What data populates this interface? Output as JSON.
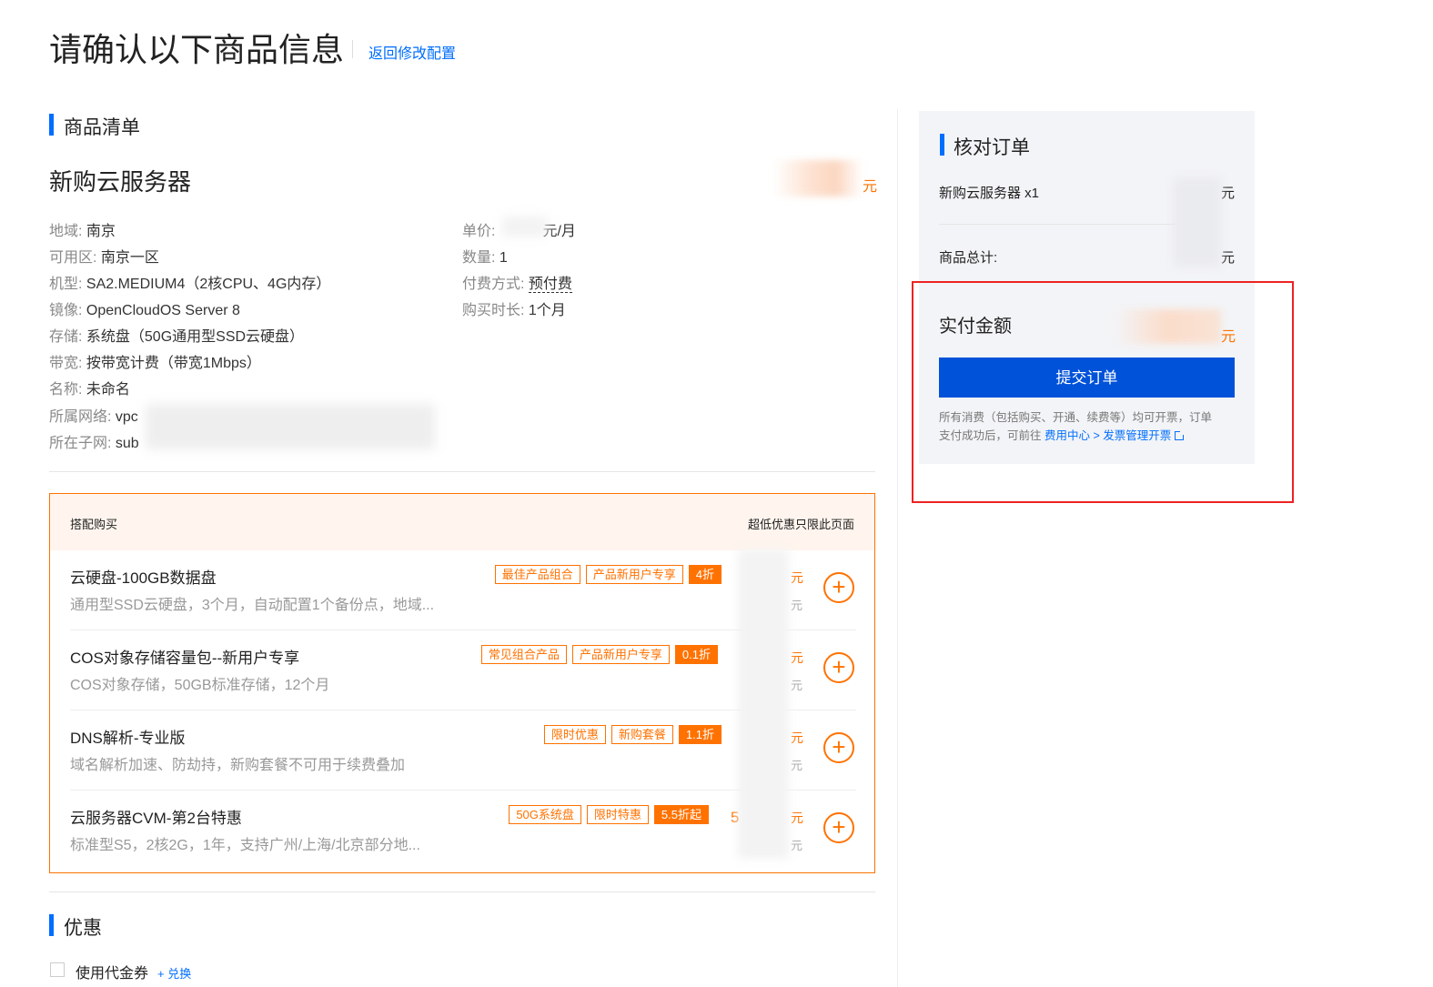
{
  "header": {
    "title": "请确认以下商品信息",
    "back_link": "返回修改配置"
  },
  "product_list": {
    "section_title": "商品清单",
    "product_name": "新购云服务器",
    "price_unit": "元",
    "specs_left": [
      {
        "label": "地域:",
        "value": "南京"
      },
      {
        "label": "可用区:",
        "value": "南京一区"
      },
      {
        "label": "机型:",
        "value": "SA2.MEDIUM4（2核CPU、4G内存）"
      },
      {
        "label": "镜像:",
        "value": "OpenCloudOS Server 8"
      },
      {
        "label": "存储:",
        "value": "系统盘（50G通用型SSD云硬盘）"
      },
      {
        "label": "带宽:",
        "value": "按带宽计费（带宽1Mbps）"
      },
      {
        "label": "名称:",
        "value": "未命名"
      },
      {
        "label": "所属网络:",
        "value": "vpc"
      },
      {
        "label": "所在子网:",
        "value": "sub"
      }
    ],
    "specs_right": [
      {
        "label": "单价:",
        "value": "元/月"
      },
      {
        "label": "数量:",
        "value": "1"
      },
      {
        "label": "付费方式:",
        "value": "预付费"
      },
      {
        "label": "购买时长:",
        "value": "1个月"
      }
    ]
  },
  "addons": {
    "header_left": "搭配购买",
    "header_right": "超低优惠只限此页面",
    "yuan": "元",
    "items": [
      {
        "name": "云硬盘-100GB数据盘",
        "desc": "通用型SSD云硬盘，3个月，自动配置1个备份点，地域...",
        "tags": [
          "最佳产品组合",
          "产品新用户专享"
        ],
        "discount": "4折"
      },
      {
        "name": "COS对象存储容量包--新用户专享",
        "desc": "COS对象存储，50GB标准存储，12个月",
        "tags": [
          "常见组合产品",
          "产品新用户专享"
        ],
        "discount": "0.1折"
      },
      {
        "name": "DNS解析-专业版",
        "desc": "域名解析加速、防劫持，新购套餐不可用于续费叠加",
        "tags": [
          "限时优惠",
          "新购套餐"
        ],
        "discount": "1.1折"
      },
      {
        "name": "云服务器CVM-第2台特惠",
        "desc": "标准型S5，2核2G，1年，支持广州/上海/北京部分地...",
        "tags": [
          "50G系统盘",
          "限时特惠"
        ],
        "discount": "5.5折起",
        "price_partial": "5"
      }
    ]
  },
  "discount": {
    "section_title": "优惠",
    "voucher_label": "使用代金券",
    "redeem_link": "+ 兑换"
  },
  "order_summary": {
    "title": "核对订单",
    "item_label": "新购云服务器 x1",
    "total_label": "商品总计:",
    "yuan": "元",
    "pay_label": "实付金额",
    "submit": "提交订单",
    "note_line1": "所有消费（包括购买、开通、续费等）均可开票，订单",
    "note_line2_prefix": "支付成功后，可前往",
    "note_link": "费用中心 > 发票管理开票"
  },
  "colors": {
    "primary": "#006eff",
    "button": "#0052d9",
    "accent": "#ff7200",
    "highlight_frame": "#ee2222"
  }
}
